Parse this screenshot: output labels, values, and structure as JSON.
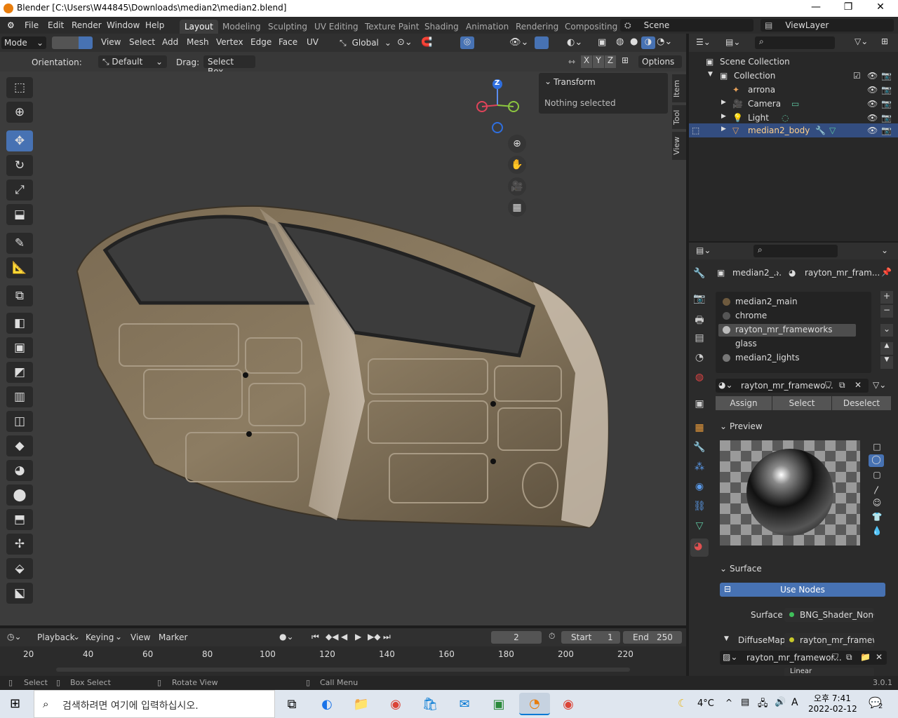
{
  "window": {
    "title": "Blender [C:\\Users\\W44845\\Downloads\\median2\\median2.blend]",
    "min": "—",
    "max": "❐",
    "close": "✕"
  },
  "menus": [
    "File",
    "Edit",
    "Render",
    "Window",
    "Help"
  ],
  "workspaces": [
    "Layout",
    "Modeling",
    "Sculpting",
    "UV Editing",
    "Texture Paint",
    "Shading",
    "Animation",
    "Rendering",
    "Compositing"
  ],
  "scene": {
    "label": "Scene",
    "view_layer": "ViewLayer"
  },
  "vp_header": {
    "mode": "Mode",
    "menus": [
      "View",
      "Select",
      "Add",
      "Mesh",
      "Vertex",
      "Edge",
      "Face",
      "UV"
    ],
    "transform": "Global"
  },
  "vp_header2": {
    "orientation_label": "Orientation:",
    "orientation": "Default",
    "drag_label": "Drag:",
    "drag": "Select Box",
    "axes": [
      "X",
      "Y",
      "Z"
    ],
    "options": "Options"
  },
  "npanel": {
    "title": "Transform",
    "body": "Nothing selected"
  },
  "vtabs": [
    "Item",
    "Tool",
    "View"
  ],
  "gizmo": {
    "z": "Z"
  },
  "outliner": {
    "scene_collection": "Scene Collection",
    "collection": "Collection",
    "items": [
      "arrona",
      "Camera",
      "Light",
      "median2_body"
    ]
  },
  "props": {
    "breadcrumb_obj": "median2_...",
    "breadcrumb_mat": "rayton_mr_fram...",
    "materials": [
      "median2_main",
      "chrome",
      "rayton_mr_frameworks",
      "glass",
      "median2_lights"
    ],
    "material_field": "rayton_mr_framewo...",
    "buttons": [
      "Assign",
      "Select",
      "Deselect"
    ],
    "preview": "Preview",
    "surface_section": "Surface",
    "use_nodes": "Use Nodes",
    "surface_label": "Surface",
    "surface_value": "BNG_Shader_NonO...",
    "diffuse_label": "DiffuseMap",
    "diffuse_value": "rayton_mr_framew...",
    "image_field": "rayton_mr_framewor...",
    "linear": "Linear"
  },
  "timeline": {
    "playback": "Playback",
    "keying": "Keying",
    "view": "View",
    "marker": "Marker",
    "frame": "2",
    "start_label": "Start",
    "start": "1",
    "end_label": "End",
    "end": "250",
    "ticks": [
      "20",
      "40",
      "60",
      "80",
      "100",
      "120",
      "140",
      "160",
      "180",
      "200",
      "220"
    ]
  },
  "status": {
    "select": "Select",
    "box_select": "Box Select",
    "rotate": "Rotate View",
    "call_menu": "Call Menu",
    "version": "3.0.1"
  },
  "taskbar": {
    "search": "검색하려면 여기에 입력하십시오.",
    "temp": "4°C",
    "lang": "A",
    "time": "오후 7:41",
    "date": "2022-02-12",
    "notif": "2"
  },
  "colors": {
    "accent": "#4772b3",
    "selected_row": "#334d80",
    "blender_orange": "#e87d0d"
  }
}
